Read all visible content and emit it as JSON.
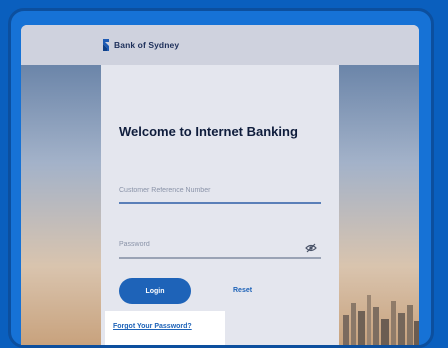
{
  "brand": {
    "name": "Bank of Sydney",
    "accent": "#1e63b8"
  },
  "login": {
    "heading": "Welcome to Internet Banking",
    "crn_placeholder": "Customer Reference Number",
    "password_placeholder": "Password",
    "login_label": "Login",
    "reset_label": "Reset",
    "forgot_label": "Forgot Your Password?"
  },
  "icons": {
    "logo": "bank-logo-icon",
    "password_toggle": "eye-slash-icon"
  }
}
